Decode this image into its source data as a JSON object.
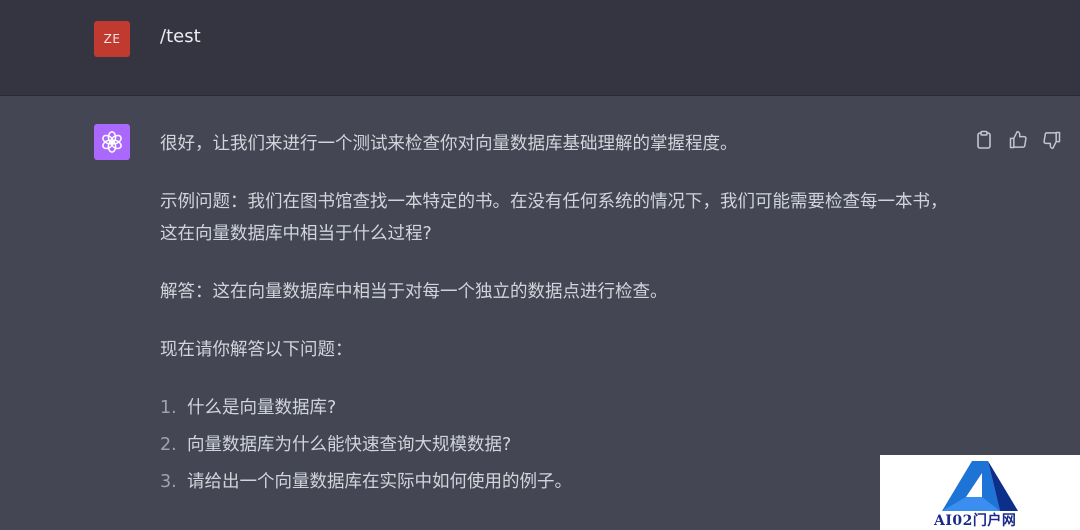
{
  "user_message": {
    "avatar_initials": "ZE",
    "text": "/test"
  },
  "assistant_message": {
    "avatar_icon": "openai-logo-icon",
    "paragraphs": [
      "很好，让我们来进行一个测试来检查你对向量数据库基础理解的掌握程度。",
      "示例问题：我们在图书馆查找一本特定的书。在没有任何系统的情况下，我们可能需要检查每一本书，这在向量数据库中相当于什么过程?",
      "解答：这在向量数据库中相当于对每一个独立的数据点进行检查。",
      "现在请你解答以下问题："
    ],
    "list": [
      {
        "num": "1.",
        "text": "什么是向量数据库?"
      },
      {
        "num": "2.",
        "text": "向量数据库为什么能快速查询大规模数据?"
      },
      {
        "num": "3.",
        "text": "请给出一个向量数据库在实际中如何使用的例子。"
      }
    ],
    "actions": [
      "clipboard-icon",
      "thumbs-up-icon",
      "thumbs-down-icon"
    ]
  },
  "watermark": {
    "text": "AI02门户网",
    "logo": "ai02-logo"
  },
  "colors": {
    "user_bg": "#343541",
    "assistant_bg": "#444654",
    "user_avatar": "#c03a30",
    "assistant_avatar": "#ab68ff"
  }
}
